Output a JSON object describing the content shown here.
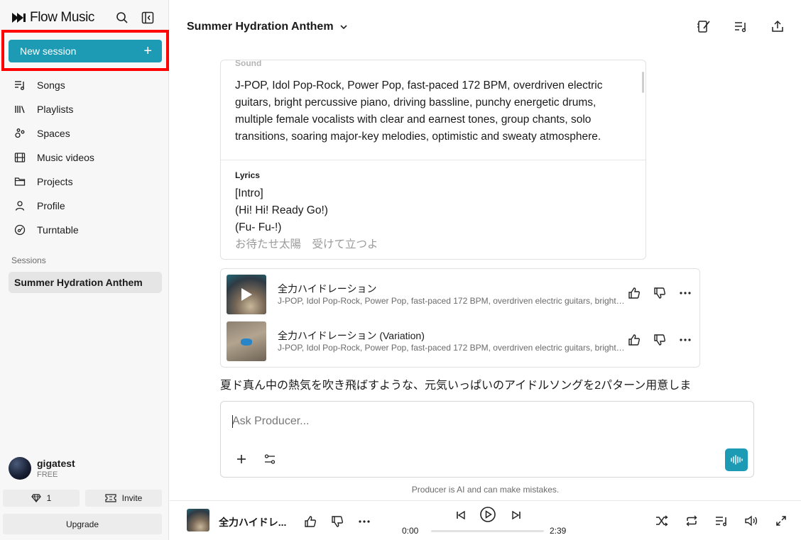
{
  "app": {
    "name": "Flow Music"
  },
  "sidebar": {
    "new_session_label": "New session",
    "items": [
      {
        "label": "Songs",
        "icon": "songs-icon"
      },
      {
        "label": "Playlists",
        "icon": "playlists-icon"
      },
      {
        "label": "Spaces",
        "icon": "spaces-icon"
      },
      {
        "label": "Music videos",
        "icon": "film-icon"
      },
      {
        "label": "Projects",
        "icon": "folder-icon"
      },
      {
        "label": "Profile",
        "icon": "user-icon"
      },
      {
        "label": "Turntable",
        "icon": "turntable-icon"
      }
    ],
    "sessions_label": "Sessions",
    "sessions": [
      {
        "label": "Summer Hydration Anthem",
        "active": true
      }
    ],
    "user": {
      "name": "gigatest",
      "plan": "FREE"
    },
    "credits": "1",
    "invite_label": "Invite",
    "upgrade_label": "Upgrade"
  },
  "header": {
    "title": "Summer Hydration Anthem"
  },
  "prompt_card": {
    "sound_label": "Sound",
    "sound_text": "J-POP, Idol Pop-Rock, Power Pop, fast-paced 172 BPM, overdriven electric guitars, bright percussive piano, driving bassline, punchy energetic drums, multiple female vocalists with clear and earnest tones, group chants, solo transitions, soaring major-key melodies, optimistic and sweaty atmosphere.",
    "lyrics_label": "Lyrics",
    "lyrics": [
      "[Intro]",
      "(Hi! Hi! Ready Go!)",
      "(Fu- Fu-!)",
      "お待たせ太陽　受けて立つよ"
    ]
  },
  "tracks": [
    {
      "title": "全力ハイドレーション",
      "subtitle": "J-POP, Idol Pop-Rock, Power Pop, fast-paced 172 BPM, overdriven electric guitars, bright percussive piano"
    },
    {
      "title": "全力ハイドレーション (Variation)",
      "subtitle": "J-POP, Idol Pop-Rock, Power Pop, fast-paced 172 BPM, overdriven electric guitars, bright percussive piano"
    }
  ],
  "response": {
    "text": "夏ド真ん中の熱気を吹き飛ばすような、元気いっぱいのアイドルソングを2パターン用意しま"
  },
  "composer": {
    "placeholder": "Ask Producer...",
    "disclaimer": "Producer is AI and can make mistakes."
  },
  "player": {
    "title": "全力ハイドレ...",
    "current_time": "0:00",
    "duration": "2:39",
    "progress": 0
  },
  "colors": {
    "accent": "#1d9bb5",
    "highlight": "#ff0000"
  }
}
